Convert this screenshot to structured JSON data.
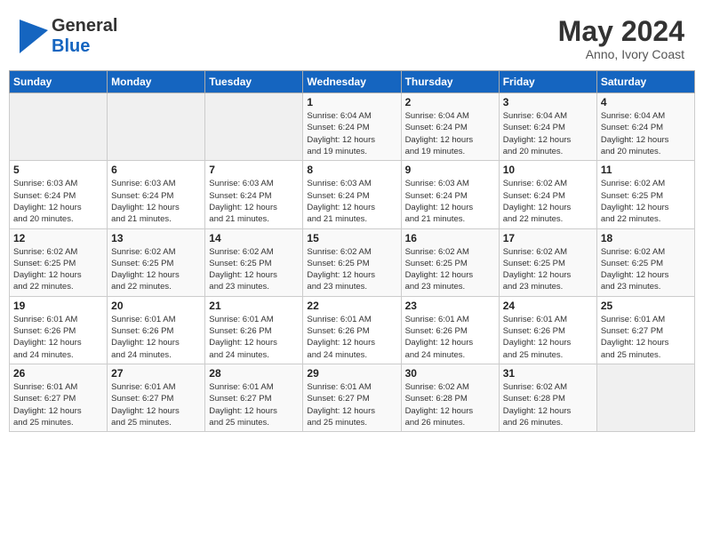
{
  "header": {
    "logo_general": "General",
    "logo_blue": "Blue",
    "month": "May 2024",
    "location": "Anno, Ivory Coast"
  },
  "days_of_week": [
    "Sunday",
    "Monday",
    "Tuesday",
    "Wednesday",
    "Thursday",
    "Friday",
    "Saturday"
  ],
  "weeks": [
    [
      {
        "day": "",
        "info": ""
      },
      {
        "day": "",
        "info": ""
      },
      {
        "day": "",
        "info": ""
      },
      {
        "day": "1",
        "info": "Sunrise: 6:04 AM\nSunset: 6:24 PM\nDaylight: 12 hours\nand 19 minutes."
      },
      {
        "day": "2",
        "info": "Sunrise: 6:04 AM\nSunset: 6:24 PM\nDaylight: 12 hours\nand 19 minutes."
      },
      {
        "day": "3",
        "info": "Sunrise: 6:04 AM\nSunset: 6:24 PM\nDaylight: 12 hours\nand 20 minutes."
      },
      {
        "day": "4",
        "info": "Sunrise: 6:04 AM\nSunset: 6:24 PM\nDaylight: 12 hours\nand 20 minutes."
      }
    ],
    [
      {
        "day": "5",
        "info": "Sunrise: 6:03 AM\nSunset: 6:24 PM\nDaylight: 12 hours\nand 20 minutes."
      },
      {
        "day": "6",
        "info": "Sunrise: 6:03 AM\nSunset: 6:24 PM\nDaylight: 12 hours\nand 21 minutes."
      },
      {
        "day": "7",
        "info": "Sunrise: 6:03 AM\nSunset: 6:24 PM\nDaylight: 12 hours\nand 21 minutes."
      },
      {
        "day": "8",
        "info": "Sunrise: 6:03 AM\nSunset: 6:24 PM\nDaylight: 12 hours\nand 21 minutes."
      },
      {
        "day": "9",
        "info": "Sunrise: 6:03 AM\nSunset: 6:24 PM\nDaylight: 12 hours\nand 21 minutes."
      },
      {
        "day": "10",
        "info": "Sunrise: 6:02 AM\nSunset: 6:24 PM\nDaylight: 12 hours\nand 22 minutes."
      },
      {
        "day": "11",
        "info": "Sunrise: 6:02 AM\nSunset: 6:25 PM\nDaylight: 12 hours\nand 22 minutes."
      }
    ],
    [
      {
        "day": "12",
        "info": "Sunrise: 6:02 AM\nSunset: 6:25 PM\nDaylight: 12 hours\nand 22 minutes."
      },
      {
        "day": "13",
        "info": "Sunrise: 6:02 AM\nSunset: 6:25 PM\nDaylight: 12 hours\nand 22 minutes."
      },
      {
        "day": "14",
        "info": "Sunrise: 6:02 AM\nSunset: 6:25 PM\nDaylight: 12 hours\nand 23 minutes."
      },
      {
        "day": "15",
        "info": "Sunrise: 6:02 AM\nSunset: 6:25 PM\nDaylight: 12 hours\nand 23 minutes."
      },
      {
        "day": "16",
        "info": "Sunrise: 6:02 AM\nSunset: 6:25 PM\nDaylight: 12 hours\nand 23 minutes."
      },
      {
        "day": "17",
        "info": "Sunrise: 6:02 AM\nSunset: 6:25 PM\nDaylight: 12 hours\nand 23 minutes."
      },
      {
        "day": "18",
        "info": "Sunrise: 6:02 AM\nSunset: 6:25 PM\nDaylight: 12 hours\nand 23 minutes."
      }
    ],
    [
      {
        "day": "19",
        "info": "Sunrise: 6:01 AM\nSunset: 6:26 PM\nDaylight: 12 hours\nand 24 minutes."
      },
      {
        "day": "20",
        "info": "Sunrise: 6:01 AM\nSunset: 6:26 PM\nDaylight: 12 hours\nand 24 minutes."
      },
      {
        "day": "21",
        "info": "Sunrise: 6:01 AM\nSunset: 6:26 PM\nDaylight: 12 hours\nand 24 minutes."
      },
      {
        "day": "22",
        "info": "Sunrise: 6:01 AM\nSunset: 6:26 PM\nDaylight: 12 hours\nand 24 minutes."
      },
      {
        "day": "23",
        "info": "Sunrise: 6:01 AM\nSunset: 6:26 PM\nDaylight: 12 hours\nand 24 minutes."
      },
      {
        "day": "24",
        "info": "Sunrise: 6:01 AM\nSunset: 6:26 PM\nDaylight: 12 hours\nand 25 minutes."
      },
      {
        "day": "25",
        "info": "Sunrise: 6:01 AM\nSunset: 6:27 PM\nDaylight: 12 hours\nand 25 minutes."
      }
    ],
    [
      {
        "day": "26",
        "info": "Sunrise: 6:01 AM\nSunset: 6:27 PM\nDaylight: 12 hours\nand 25 minutes."
      },
      {
        "day": "27",
        "info": "Sunrise: 6:01 AM\nSunset: 6:27 PM\nDaylight: 12 hours\nand 25 minutes."
      },
      {
        "day": "28",
        "info": "Sunrise: 6:01 AM\nSunset: 6:27 PM\nDaylight: 12 hours\nand 25 minutes."
      },
      {
        "day": "29",
        "info": "Sunrise: 6:01 AM\nSunset: 6:27 PM\nDaylight: 12 hours\nand 25 minutes."
      },
      {
        "day": "30",
        "info": "Sunrise: 6:02 AM\nSunset: 6:28 PM\nDaylight: 12 hours\nand 26 minutes."
      },
      {
        "day": "31",
        "info": "Sunrise: 6:02 AM\nSunset: 6:28 PM\nDaylight: 12 hours\nand 26 minutes."
      },
      {
        "day": "",
        "info": ""
      }
    ]
  ]
}
